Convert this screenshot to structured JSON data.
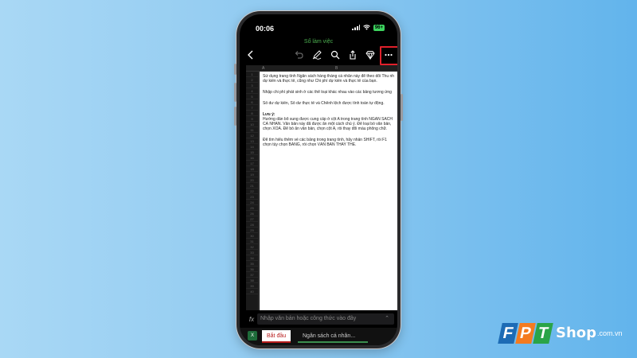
{
  "status": {
    "time": "00:06",
    "battery": "96+"
  },
  "app": {
    "doc_title": "Sổ làm việc"
  },
  "sheet": {
    "columns": [
      "A",
      "B"
    ],
    "rows": [
      "1",
      "2",
      "3",
      "4",
      "5",
      "6",
      "7",
      "8",
      "9",
      "10",
      "11",
      "12",
      "13",
      "14",
      "15",
      "16",
      "17",
      "18",
      "19",
      "20",
      "21",
      "22",
      "23",
      "24",
      "25",
      "26",
      "27",
      "28",
      "29",
      "30",
      "31",
      "32",
      "33",
      "34",
      "35",
      "36",
      "37",
      "38",
      "39",
      "40"
    ],
    "lines": [
      "Sử dụng trang tính Ngân sách hàng tháng cá nhân này để theo dõi Thu nhập",
      "dự kiến và thực tế, cũng như Chi phí dự kiến và thực tế của bạn.",
      "Nhập chi phí phát sinh ở các thể loại khác nhau vào các bảng tương ứng",
      "Số dư dự kiến, Số dư thực tế và Chênh lệch được tính toán tự động.",
      "Lưu ý:",
      "Hướng dẫn bổ sung được cung cấp ở cột A trong trang tính NGÂN SÁCH",
      "CÁ NHÂN. Văn bản này đã được ẩn một cách chủ ý. Để loại bỏ văn bản,",
      "chọn XÓA. Để bỏ ẩn văn bản, chọn cột A, rồi thay đổi màu phông chữ.",
      "Để tìm hiểu thêm về các bảng trong trang tính, hãy nhấn SHIFT, rồi F1",
      "chọn tùy chọn BẢNG, rồi chọn VĂN BẢN THAY THẾ."
    ]
  },
  "formula_bar": {
    "placeholder": "Nhập văn bản hoặc công thức vào đây"
  },
  "tabs": [
    {
      "label": "Bắt đầu"
    },
    {
      "label": "Ngân sách cá nhân..."
    }
  ],
  "logo": {
    "letters": [
      "F",
      "P",
      "T"
    ],
    "shop": "Shop",
    "domain": ".com.vn"
  },
  "colors": {
    "highlight": "#e0202b",
    "title_green": "#4caf50"
  }
}
